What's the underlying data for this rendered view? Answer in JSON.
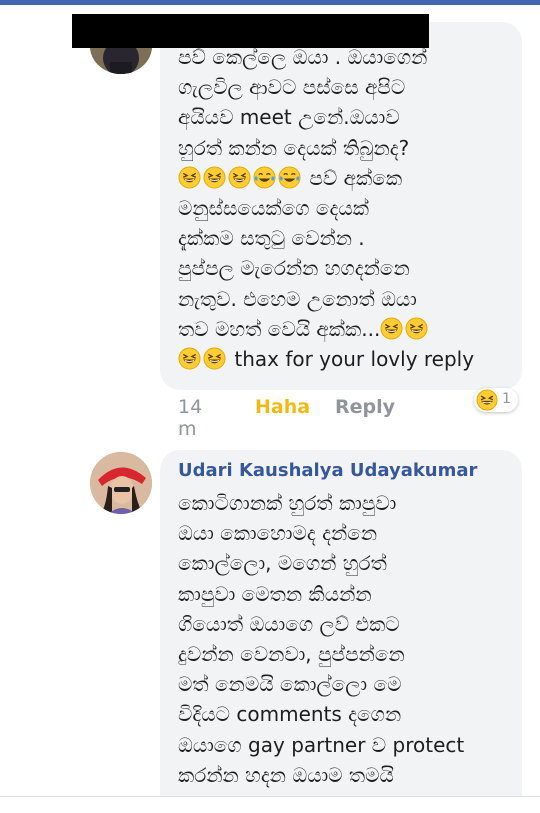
{
  "comment1": {
    "lines": [
      "පව් කෙල්ලෙ ඔයා . ඔයාගෙන්",
      "ගැලවිල ආවට පස්සෙ අපිට",
      "අයියව meet උනේ.ඔයාව",
      "හුරත් කන්න දෙයක් තිබුනද?",
      " පව් අක්කෙ",
      "මනුස්සයෙක්ගෙ දෙයක්",
      "දැක්කම සතුටු වෙන්න .",
      "පුප්පල මැරෙන්න හගදන්නෙ",
      "නැතුව. එහෙම උනොත් ඔයා",
      "තව මහත් වෙයි අක්ක...",
      " thax for your lovly reply"
    ],
    "time": "14 m",
    "reaction_label": "Haha",
    "reply_label": "Reply",
    "reaction_count": "1"
  },
  "comment2": {
    "author": "Udari Kaushalya Udayakumar",
    "lines": [
      "කොටිගානක් හුරත් කාපුවා",
      "ඔයා කොහොමද දන්නෙ",
      "කොල්ලො, මගෙන් හුරත්",
      "කාපුවා මෙතන කියන්න",
      "ගියොත් ඔයාගෙ ලව් එකට",
      "දුවන්න වෙනවා, පුප්පන්නෙ",
      "මත් නෙමයි කොල්ලො මෙ",
      "විදියට comments දගෙන",
      "ඔයාගෙ gay partner ව protect",
      "කරන්න හදන ඔයාම තමයි"
    ]
  },
  "icons": {
    "laugh": "grinning-squinting-face-icon",
    "cry_laugh": "face-with-tears-of-joy-icon"
  },
  "colors": {
    "accent": "#4267b2",
    "name": "#365899",
    "haha": "#f0ba15",
    "bubble": "#f2f3f5",
    "meta": "#90949c"
  }
}
